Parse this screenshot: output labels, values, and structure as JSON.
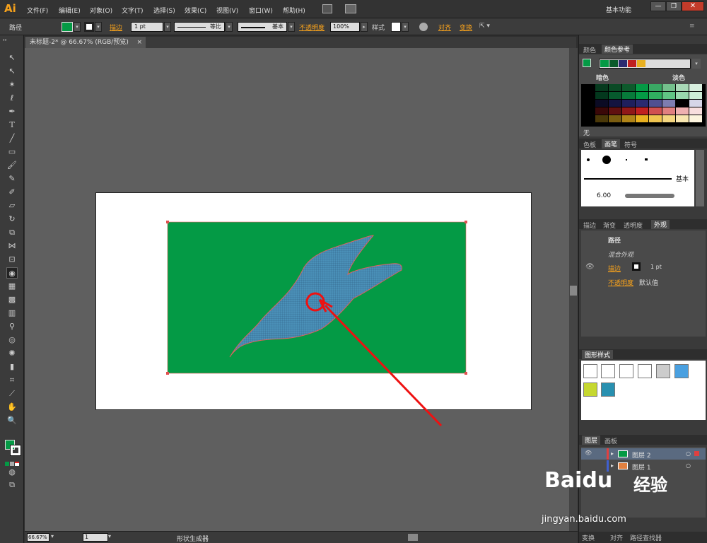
{
  "app": {
    "logo": "Ai",
    "workspace": "基本功能"
  },
  "menu": [
    "文件(F)",
    "编辑(E)",
    "对象(O)",
    "文字(T)",
    "选择(S)",
    "效果(C)",
    "视图(V)",
    "窗口(W)",
    "帮助(H)"
  ],
  "control": {
    "object_type": "路径",
    "stroke_label": "描边",
    "stroke_weight": "1 pt",
    "profile": "等比",
    "brush": "基本",
    "opacity_label": "不透明度",
    "opacity": "100%",
    "style_label": "样式",
    "align": "对齐",
    "transform": "变换"
  },
  "document": {
    "tab": "未标题-2* @ 66.67% (RGB/预览)"
  },
  "colors": {
    "fill": "#049a45",
    "shape": "#4a90b8",
    "arrow": "#ee1111",
    "accent": "#f7a21c"
  },
  "swatch_panel": {
    "tabs": [
      "颜色",
      "颜色参考"
    ],
    "dark": "暗色",
    "light": "淡色",
    "footer": "无"
  },
  "brush_panel": {
    "tabs": [
      "色板",
      "画笔",
      "符号"
    ],
    "basic": "基本",
    "size": "6.00"
  },
  "appearance_panel": {
    "tabs": [
      "描边",
      "渐变",
      "透明度",
      "外观"
    ],
    "title": "路径",
    "group": "混合外观",
    "stroke": "描边",
    "stroke_value": "1 pt",
    "opacity": "不透明度",
    "opacity_value": "默认值"
  },
  "graphic_styles": {
    "tab": "图形样式"
  },
  "layers": {
    "tabs": [
      "图层",
      "画板"
    ],
    "items": [
      {
        "name": "图层 2"
      },
      {
        "name": "图层 1"
      }
    ]
  },
  "bottom_panels": {
    "tabs": [
      "变换",
      "对齐",
      "路径查找器"
    ]
  },
  "status": {
    "zoom": "66.67%",
    "page": "1",
    "tool": "形状生成器"
  },
  "watermark": {
    "brand": "Baidu",
    "cn": "经验",
    "url": "jingyan.baidu.com"
  }
}
